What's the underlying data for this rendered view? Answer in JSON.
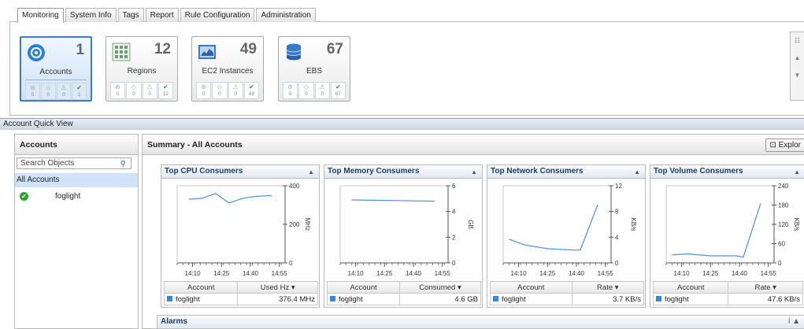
{
  "tabs": [
    "Monitoring",
    "System Info",
    "Tags",
    "Report",
    "Rule Configuration",
    "Administration"
  ],
  "tiles": [
    {
      "label": "Accounts",
      "count": "1",
      "stats": [
        "0",
        "0",
        "0",
        "1"
      ]
    },
    {
      "label": "Regions",
      "count": "12",
      "stats": [
        "0",
        "0",
        "0",
        "12"
      ]
    },
    {
      "label": "EC2 Instances",
      "count": "49",
      "stats": [
        "0",
        "0",
        "0",
        "49"
      ]
    },
    {
      "label": "EBS",
      "count": "67",
      "stats": [
        "0",
        "0",
        "0",
        "67"
      ]
    }
  ],
  "quick_view_title": "Account Quick View",
  "left_panel": {
    "title": "Accounts",
    "search_placeholder": "Search Objects",
    "all_accounts": "All Accounts",
    "account": "foglight"
  },
  "summary": {
    "title": "Summary - All Accounts",
    "explore_label": "Explor"
  },
  "cards": [
    {
      "title": "Top CPU Consumers",
      "col1": "Account",
      "col2": "Used Hz ▾",
      "account": "foglight",
      "value": "376.4 MHz",
      "unit": "MHz",
      "ticks": [
        "400",
        "200",
        "0"
      ]
    },
    {
      "title": "Top Memory Consumers",
      "col1": "Account",
      "col2": "Consumed ▾",
      "account": "foglight",
      "value": "4.6 GB",
      "unit": "GB",
      "ticks": [
        "6",
        "4",
        "2",
        "0"
      ]
    },
    {
      "title": "Top Network Consumers",
      "col1": "Account",
      "col2": "Rate ▾",
      "account": "foglight",
      "value": "3.7 KB/s",
      "unit": "KB/s",
      "ticks": [
        "12",
        "8",
        "4",
        "0"
      ]
    },
    {
      "title": "Top Volume Consumers",
      "col1": "Account",
      "col2": "Rate ▾",
      "account": "foglight",
      "value": "47.6 KB/s",
      "unit": "KB/s",
      "ticks": [
        "240",
        "180",
        "120",
        "60",
        "0"
      ]
    }
  ],
  "x_ticks": [
    "14:10",
    "14:25",
    "14:40",
    "14:55"
  ],
  "chart_data": [
    {
      "type": "line",
      "title": "Top CPU Consumers",
      "x": [
        "14:08",
        "14:15",
        "14:22",
        "14:29",
        "14:36",
        "14:43",
        "14:51"
      ],
      "series": [
        {
          "values": [
            330,
            335,
            360,
            310,
            335,
            345,
            350
          ]
        }
      ],
      "ylim": [
        0,
        400
      ],
      "ylabel": "MHz"
    },
    {
      "type": "line",
      "title": "Top Memory Consumers",
      "x": [
        "14:08",
        "14:51"
      ],
      "series": [
        {
          "values": [
            4.9,
            4.8
          ]
        }
      ],
      "ylim": [
        0,
        6
      ],
      "ylabel": "GB"
    },
    {
      "type": "line",
      "title": "Top Network Consumers",
      "x": [
        "14:05",
        "14:13",
        "14:25",
        "14:38",
        "14:42",
        "14:51"
      ],
      "series": [
        {
          "values": [
            3.7,
            2.8,
            2.2,
            2.0,
            2.0,
            9.0
          ]
        }
      ],
      "ylim": [
        0,
        12
      ],
      "ylabel": "KB/s"
    },
    {
      "type": "line",
      "title": "Top Volume Consumers",
      "x": [
        "14:05",
        "14:13",
        "14:25",
        "14:38",
        "14:42",
        "14:51"
      ],
      "series": [
        {
          "values": [
            25,
            28,
            22,
            22,
            18,
            185
          ]
        }
      ],
      "ylim": [
        0,
        240
      ],
      "ylabel": "KB/s"
    }
  ],
  "alarms_title": "Alarms",
  "alarms_info": "i ▲"
}
